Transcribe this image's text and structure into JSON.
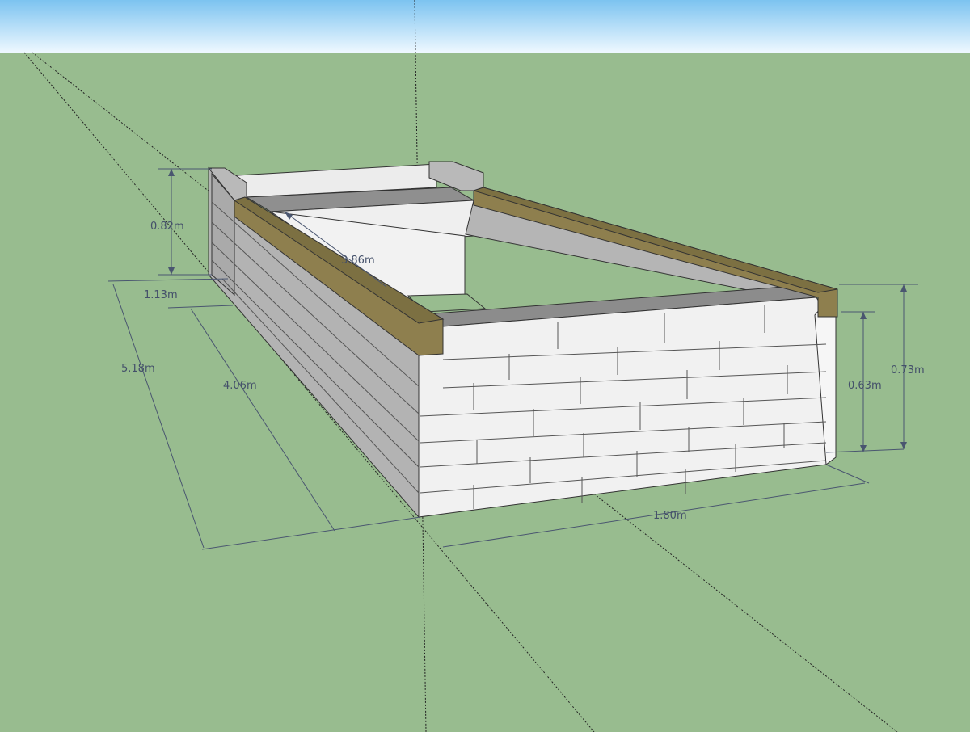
{
  "dimensions": {
    "overall_height": "0.82m",
    "step_depth": "1.13m",
    "overall_length": "5.18m",
    "lower_length": "4.06m",
    "inner_length": "3.86m",
    "width": "1.80m",
    "lower_height": "0.63m",
    "front_height": "0.73m"
  },
  "colors": {
    "sky_top": "#7cc3f0",
    "sky_bottom": "#eef8ff",
    "ground": "#98bc8f",
    "block_face": "#f1f1f1",
    "block_side": "#b2b2b2",
    "block_top": "#9a9a9a",
    "timber": "#8e7f4e",
    "dimension_line": "#4a5670"
  }
}
